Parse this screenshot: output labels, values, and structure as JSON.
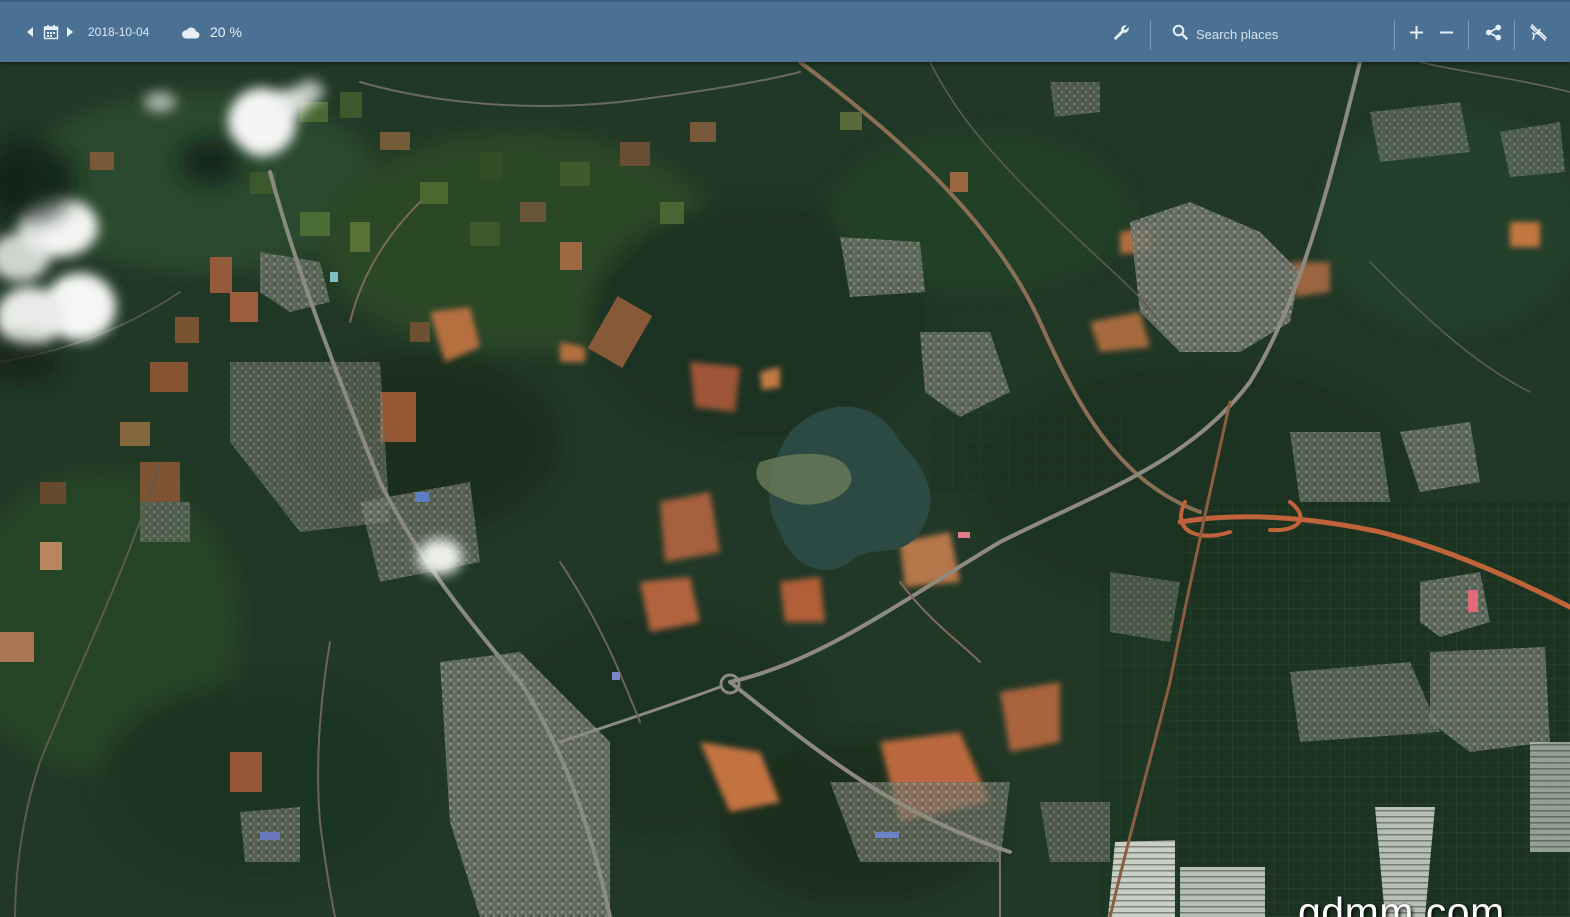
{
  "toolbar": {
    "date": "2018-10-04",
    "cloud_coverage": "20 %",
    "search_placeholder": "Search places",
    "icons": {
      "date_prev": "caret-left-icon",
      "calendar": "calendar-icon",
      "date_next": "caret-right-icon",
      "cloud": "cloud-icon",
      "tools": "wrench-icon",
      "search": "search-icon",
      "zoom_in": "plus-icon",
      "zoom_out": "minus-icon",
      "share": "share-icon",
      "layers": "satellite-icon"
    },
    "colors": {
      "background": "#4a7194",
      "icon": "#e6eef6"
    }
  },
  "map": {
    "imagery": "satellite",
    "watermark": "gdmm.com"
  }
}
